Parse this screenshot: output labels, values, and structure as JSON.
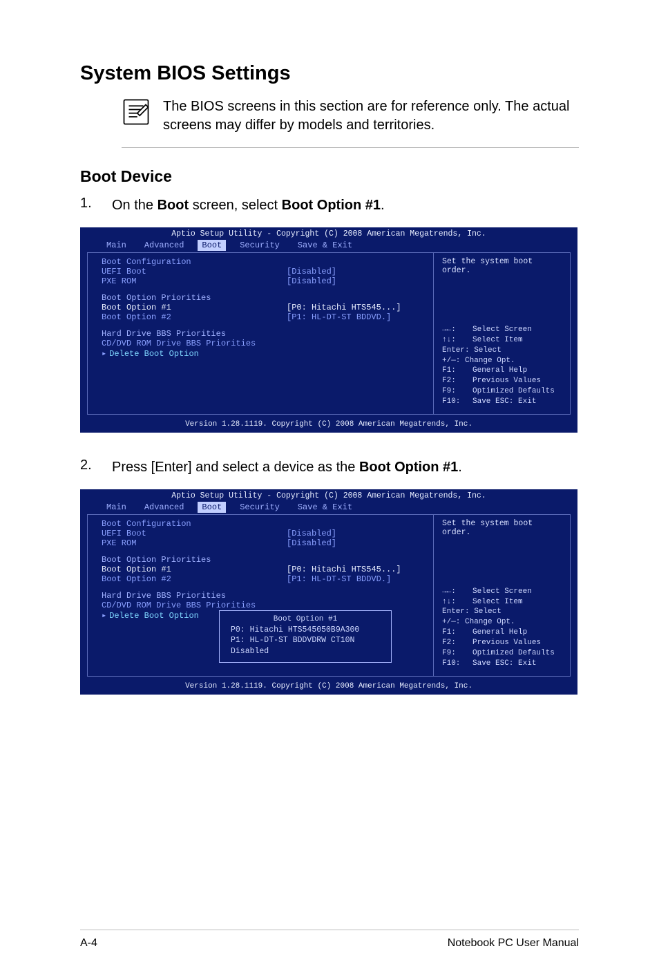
{
  "heading": "System BIOS Settings",
  "note": "The BIOS screens in this section are for reference only. The actual screens may differ by models and territories.",
  "subheading": "Boot Device",
  "step1": {
    "num": "1.",
    "pre": "On the ",
    "b1": "Boot",
    "mid": " screen, select ",
    "b2": "Boot Option #1",
    "post": "."
  },
  "step2": {
    "num": "2.",
    "pre": "Press [Enter] and select a device as the ",
    "b1": "Boot Option #1",
    "post": "."
  },
  "bios": {
    "title": "Aptio Setup Utility - Copyright (C) 2008 American Megatrends, Inc.",
    "tabs": {
      "main": "Main",
      "advanced": "Advanced",
      "boot": "Boot",
      "security": "Security",
      "save": "Save & Exit"
    },
    "desc": "Set the system boot order.",
    "lines": {
      "bootconfig": "Boot Configuration",
      "uefi": {
        "label": "UEFI Boot",
        "value": "[Disabled]"
      },
      "pxe": {
        "label": "PXE ROM",
        "value": "[Disabled]"
      },
      "priorities": "Boot Option Priorities",
      "opt1": {
        "label": "Boot Option #1",
        "value": "[P0: Hitachi HTS545...]"
      },
      "opt2": {
        "label": "Boot Option #2",
        "value": "[P1: HL-DT-ST BDDVD.]"
      },
      "hd": "Hard Drive BBS Priorities",
      "cd": "CD/DVD ROM Drive BBS Priorities",
      "del": "Delete Boot Option"
    },
    "help": {
      "select_screen": "Select Screen",
      "select_item": "Select Item",
      "enter": "Enter: Select",
      "change": "+/—: Change Opt.",
      "f1": "General Help",
      "f2": "Previous Values",
      "f9": "Optimized Defaults",
      "f10": "Save    ESC: Exit"
    },
    "foot": "Version 1.28.1119. Copyright (C) 2008 American Megatrends, Inc.",
    "popup": {
      "title": "Boot Option #1",
      "o1": "P0: Hitachi HTS545050B9A300",
      "o2": "P1: HL-DT-ST BDDVDRW CT10N",
      "o3": "Disabled"
    }
  },
  "footer": {
    "left": "A-4",
    "right": "Notebook PC User Manual"
  }
}
